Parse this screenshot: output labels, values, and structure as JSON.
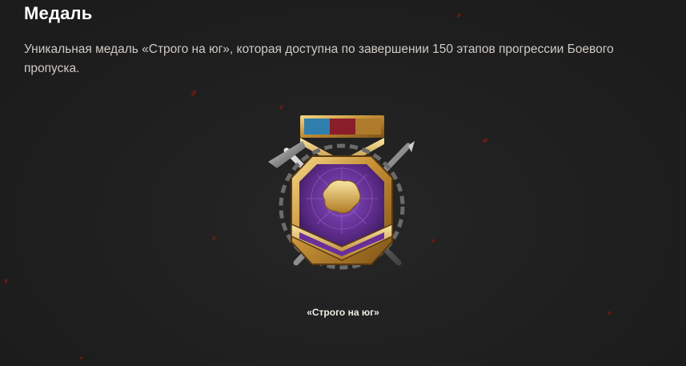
{
  "section": {
    "title": "Медаль",
    "description": "Уникальная медаль «Строго на юг», которая доступна по завершении 150 этапов прогрессии Боевого пропуска."
  },
  "medal": {
    "image_icon": "medal-strictly-south-icon",
    "caption": "«Строго на юг»"
  },
  "colors": {
    "background": "#1f1f1f",
    "ember": "#7a1a12",
    "gold": "#d4a24a",
    "purple": "#5a2a86"
  }
}
